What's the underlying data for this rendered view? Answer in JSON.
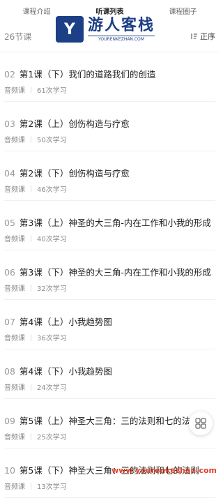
{
  "tabs": [
    {
      "label": "课程介绍",
      "active": false
    },
    {
      "label": "听课列表",
      "active": true
    },
    {
      "label": "课程圈子",
      "active": false
    }
  ],
  "subbar": {
    "count": "26节课",
    "sort_label": "正序"
  },
  "watermark": {
    "cn": "游人客栈",
    "en": "YOURENKEZHAN.COM",
    "logo_letter": "Y",
    "footer": "www.yourenkezhan.com"
  },
  "lessons": [
    {
      "idx": "02",
      "title": "第1课（下）我们的道路我们的创造",
      "type": "音频课",
      "plays": "61次学习"
    },
    {
      "idx": "03",
      "title": "第2课（上）创伤构造与疗愈",
      "type": "音频课",
      "plays": "50次学习"
    },
    {
      "idx": "04",
      "title": "第2课（下）创伤构造与疗愈",
      "type": "音频课",
      "plays": "46次学习"
    },
    {
      "idx": "05",
      "title": "第3课（上）神圣的大三角-内在工作和小我的形成",
      "type": "音频课",
      "plays": "40次学习"
    },
    {
      "idx": "06",
      "title": "第3课（下）神圣的大三角-内在工作和小我的形成",
      "type": "音频课",
      "plays": "32次学习"
    },
    {
      "idx": "07",
      "title": "第4课（上）小我趋势图",
      "type": "音频课",
      "plays": "36次学习"
    },
    {
      "idx": "08",
      "title": "第4课（下）小我趋势图",
      "type": "音频课",
      "plays": "24次学习"
    },
    {
      "idx": "09",
      "title": "第5课（上）神圣大三角：三的法则和七的法则",
      "type": "音频课",
      "plays": "25次学习"
    },
    {
      "idx": "10",
      "title": "第5课（下）神圣大三角：三的法则和七的法则",
      "type": "音频课",
      "plays": "13次学习"
    }
  ]
}
